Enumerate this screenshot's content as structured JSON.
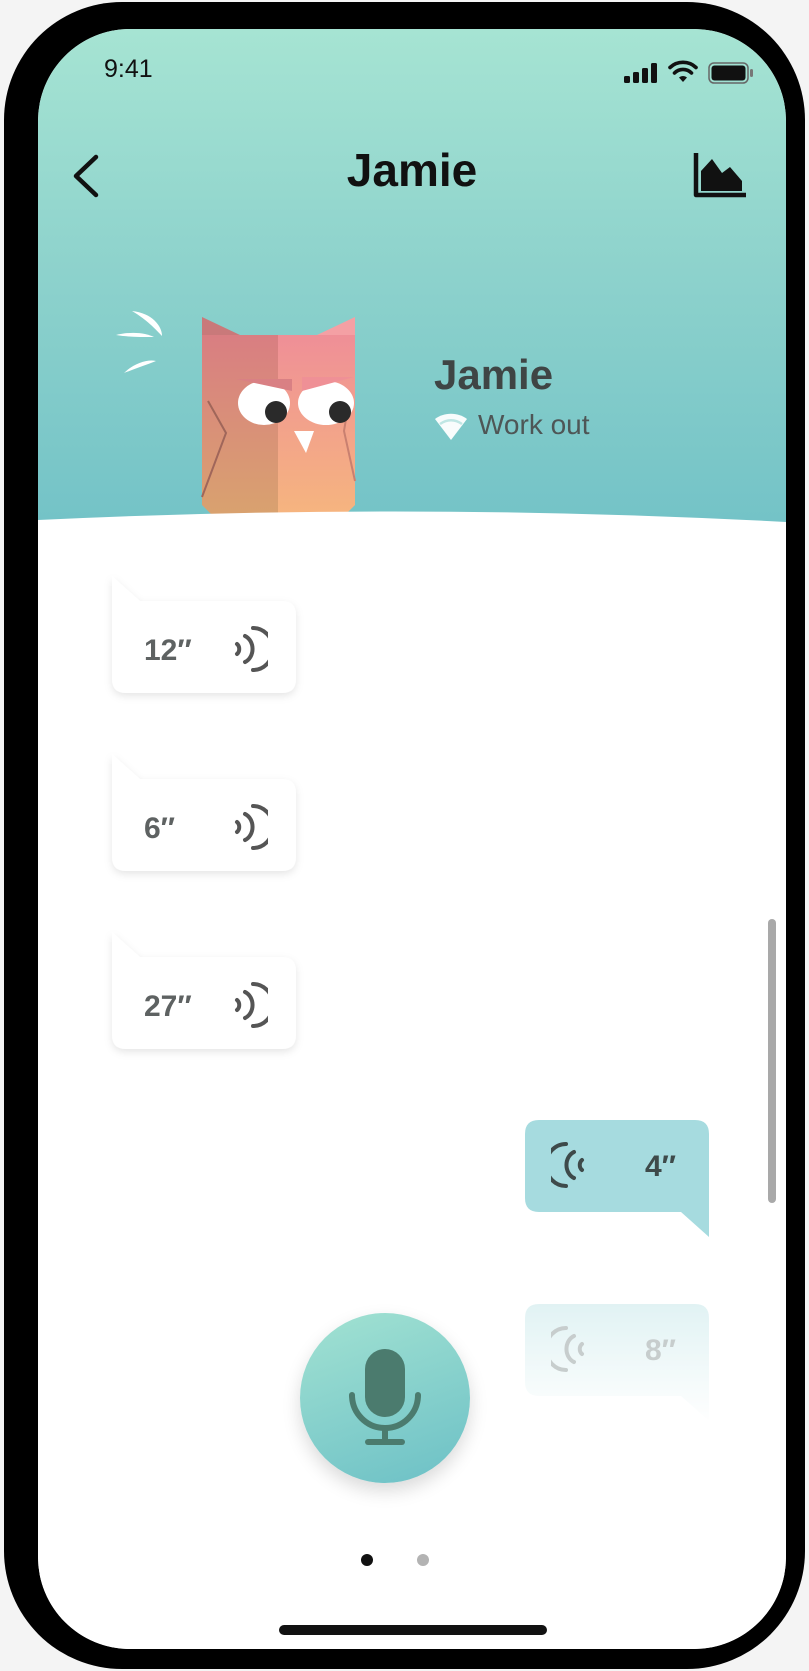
{
  "status_bar": {
    "time": "9:41"
  },
  "nav": {
    "title": "Jamie"
  },
  "contact": {
    "name": "Jamie",
    "status": "Work out"
  },
  "messages": [
    {
      "direction": "received",
      "duration": "12″"
    },
    {
      "direction": "received",
      "duration": "6″"
    },
    {
      "direction": "received",
      "duration": "27″"
    },
    {
      "direction": "sent",
      "duration": "4″"
    },
    {
      "direction": "sent",
      "duration": "8″",
      "faded": true
    }
  ],
  "pagination": {
    "pages": 2,
    "current": 1
  },
  "colors": {
    "header_top": "#a6e4d3",
    "header_bottom": "#6fc0c6",
    "sent_bubble": "#a6dbdf",
    "received_bubble": "#ffffff",
    "mic_icon": "#4b7b6e",
    "text_dark": "#3f4545"
  },
  "icons": {
    "back": "chevron-left-icon",
    "stats": "area-chart-icon",
    "mic": "microphone-icon",
    "status": "wifi-status-icon",
    "audio": "sound-wave-icon"
  }
}
